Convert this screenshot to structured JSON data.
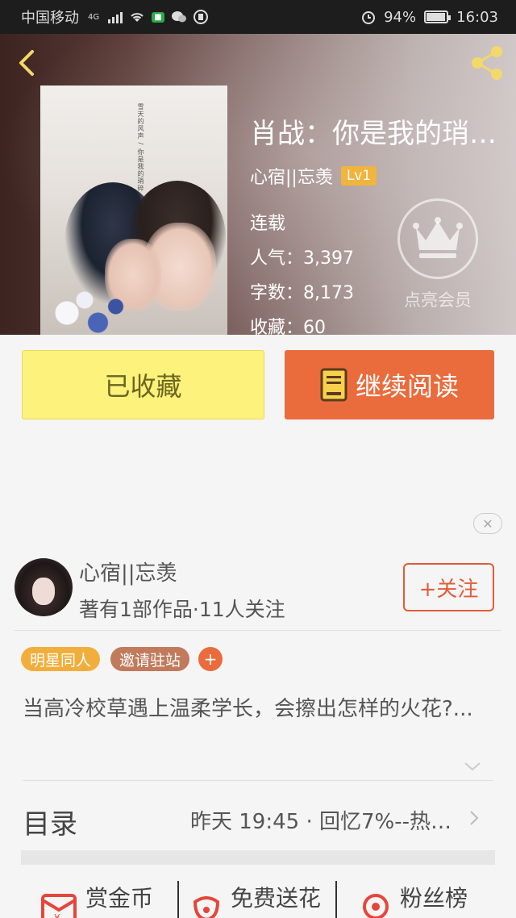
{
  "status_bar": {
    "carrier": "中国移动",
    "network": "4G",
    "battery": "94%",
    "battery_level": 0.94,
    "time": "16:03"
  },
  "book": {
    "title": "肖战：你是我的琑…",
    "author": "心宿||忘羡",
    "level": "Lv1",
    "status": "连载",
    "popularity": "人气：3,397",
    "word_count": "字数：8,173",
    "favorites": "收藏：60",
    "cover_text": "雪天的风声 / 你是我的琑碎"
  },
  "member": {
    "label": "点亮会员"
  },
  "buttons": {
    "collected": "已收藏",
    "continue_read": "继续阅读"
  },
  "author_card": {
    "name": "心宿||忘羡",
    "subtitle": "著有1部作品·11人关注",
    "follow": "+关注"
  },
  "tags": [
    "明星同人",
    "邀请驻站",
    "+"
  ],
  "description": "当高冷校草遇上温柔学长，会擦出怎样的火花?...",
  "toc": {
    "label": "目录",
    "latest": "昨天 19:45 · 回忆7%--热…"
  },
  "actions": [
    "赏金币",
    "免费送花",
    "粉丝榜"
  ],
  "colors": {
    "accent_orange": "#ea6b3c",
    "collected_yellow": "#fdf27b",
    "level_badge": "#f1b43c",
    "tag_star": "#f2ae3c",
    "tag_invite": "#c17a5c"
  },
  "icons": [
    "back-chevron-icon",
    "share-icon",
    "crown-icon",
    "book-icon",
    "close-icon",
    "chevron-down-icon",
    "chevron-right-icon",
    "red-envelope-icon",
    "flower-icon",
    "medal-icon"
  ]
}
